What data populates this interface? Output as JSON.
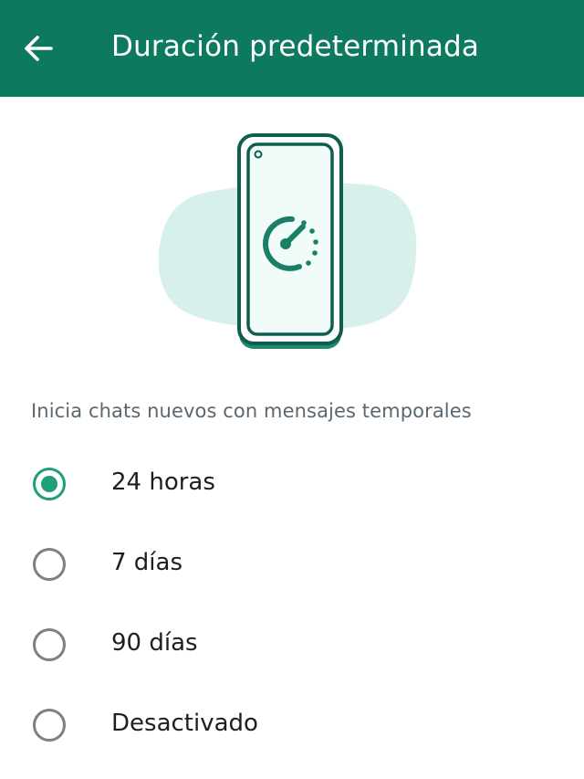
{
  "appbar": {
    "title": "Duración predeterminada",
    "back_icon": "arrow-left-icon",
    "color": "#0d7a60"
  },
  "illustration": {
    "icon": "phone-timer-icon",
    "accent": "#1a7f66",
    "blob": "#d8f0eb"
  },
  "section": {
    "label": "Inicia chats nuevos con mensajes temporales"
  },
  "options": [
    {
      "label": "24 horas",
      "selected": true
    },
    {
      "label": "7 días",
      "selected": false
    },
    {
      "label": "90 días",
      "selected": false
    },
    {
      "label": "Desactivado",
      "selected": false
    }
  ],
  "colors": {
    "accent": "#1f9e79",
    "radio_off": "#7a8187",
    "text_primary": "#1b1f22",
    "text_secondary": "#5a6770"
  }
}
